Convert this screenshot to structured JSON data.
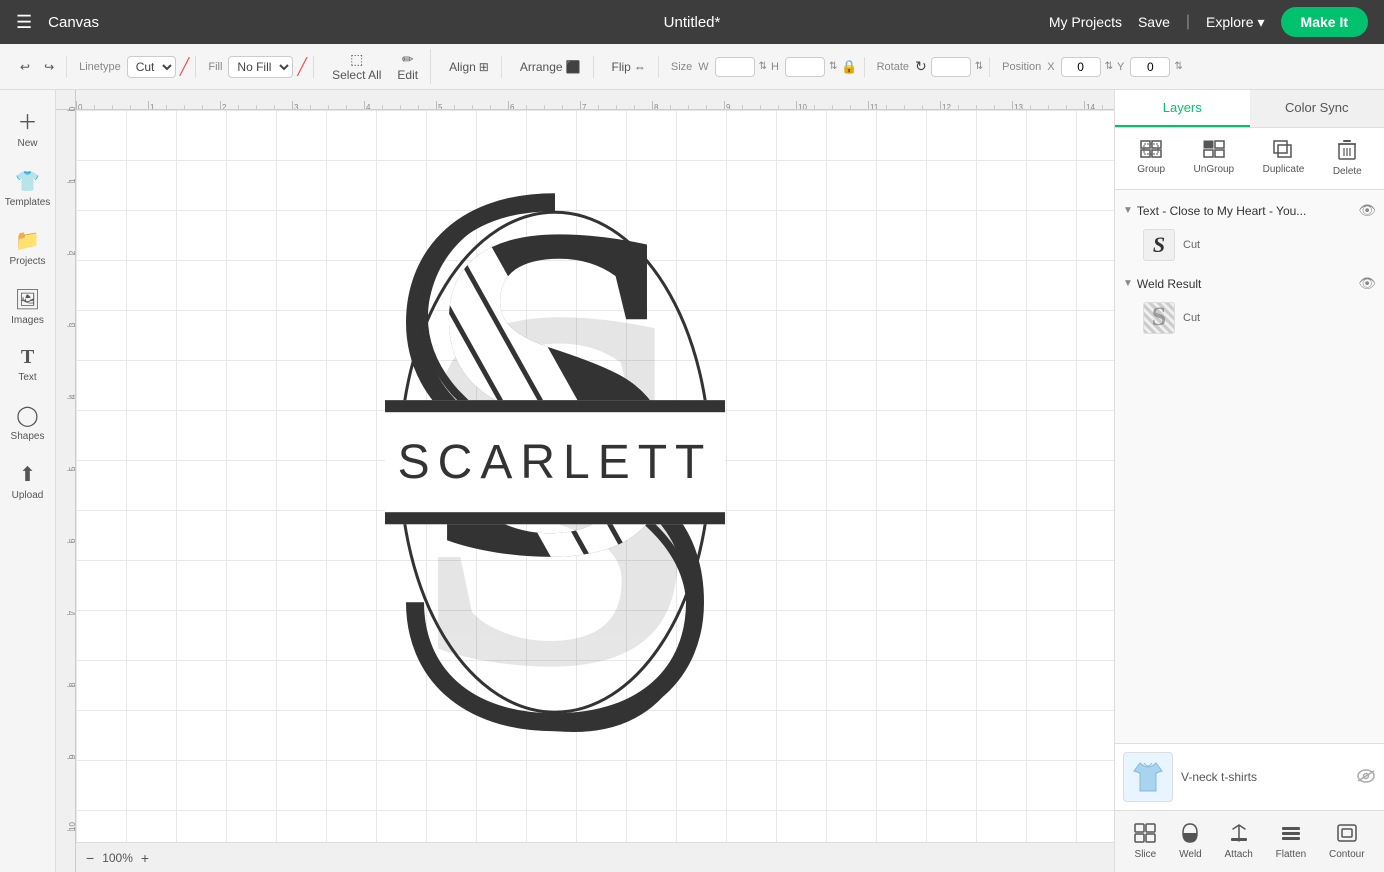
{
  "topNav": {
    "hamburger": "☰",
    "canvasLabel": "Canvas",
    "title": "Untitled*",
    "myProjectsLabel": "My Projects",
    "saveLabel": "Save",
    "exploreLabel": "Explore",
    "makeItLabel": "Make It"
  },
  "toolbar": {
    "undoIcon": "↩",
    "redoIcon": "↪",
    "linetypeLabel": "Linetype",
    "linetypeValue": "Cut",
    "fillLabel": "Fill",
    "fillValue": "No Fill",
    "selectAllLabel": "Select All",
    "editLabel": "Edit",
    "alignLabel": "Align",
    "arrangeLabel": "Arrange",
    "flipLabel": "Flip",
    "sizeLabel": "Size",
    "wLabel": "W",
    "hLabel": "H",
    "lockIcon": "🔒",
    "rotateLabel": "Rotate",
    "positionLabel": "Position",
    "xLabel": "X",
    "yLabel": "Y",
    "xValue": "0",
    "yValue": "0"
  },
  "sidebar": {
    "items": [
      {
        "icon": "＋",
        "label": "New"
      },
      {
        "icon": "👕",
        "label": "Templates"
      },
      {
        "icon": "📁",
        "label": "Projects"
      },
      {
        "icon": "🖼",
        "label": "Images"
      },
      {
        "icon": "T",
        "label": "Text"
      },
      {
        "icon": "◯",
        "label": "Shapes"
      },
      {
        "icon": "⬆",
        "label": "Upload"
      }
    ]
  },
  "canvas": {
    "zoomLevel": "100%",
    "rulerUnits": [
      0,
      1,
      2,
      3,
      4,
      5,
      6,
      7,
      8,
      9,
      10,
      11,
      12,
      13,
      14
    ]
  },
  "rightPanel": {
    "tabs": [
      {
        "label": "Layers",
        "active": true
      },
      {
        "label": "Color Sync",
        "active": false
      }
    ],
    "layerActions": [
      {
        "icon": "⬜⬛",
        "label": "Group"
      },
      {
        "icon": "⬛⬜",
        "label": "UnGroup"
      },
      {
        "icon": "❐",
        "label": "Duplicate"
      },
      {
        "icon": "🗑",
        "label": "Delete"
      }
    ],
    "layers": [
      {
        "type": "group",
        "name": "Text - Close to My Heart - You...",
        "expanded": true,
        "visible": true,
        "children": [
          {
            "thumb": "S",
            "type": "Cut",
            "isText": true
          }
        ]
      },
      {
        "type": "group",
        "name": "Weld Result",
        "expanded": true,
        "visible": true,
        "children": [
          {
            "thumb": "pattern",
            "type": "Cut",
            "isText": false
          }
        ]
      }
    ],
    "preview": {
      "label": "V-neck t-shirts",
      "eyeIcon": "👁",
      "eyeSlashed": true
    },
    "bottomActions": [
      {
        "icon": "✂",
        "label": "Slice"
      },
      {
        "icon": "⚡",
        "label": "Weld"
      },
      {
        "icon": "📎",
        "label": "Attach"
      },
      {
        "icon": "▭",
        "label": "Flatten"
      },
      {
        "icon": "⬡",
        "label": "Contour"
      }
    ]
  },
  "colors": {
    "accent": "#00c26e",
    "topNavBg": "#3d3d3d",
    "toolbarBg": "#f5f5f5",
    "canvasBg": "#e0e0e0",
    "panelBg": "#f9f9f9",
    "designColor": "#333333"
  }
}
